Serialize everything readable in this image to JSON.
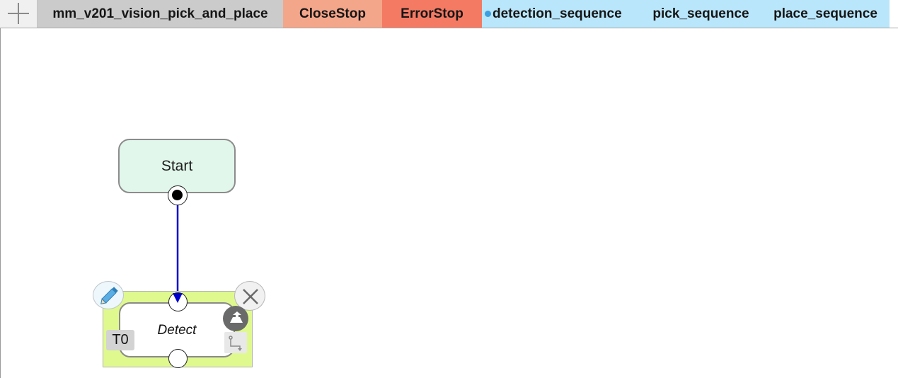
{
  "tabbar": {
    "add_icon": "plus-icon",
    "tabs": [
      {
        "label": "mm_v201_vision_pick_and_place",
        "color": "#cbcbcb"
      },
      {
        "label": "CloseStop",
        "color": "#f4a68a"
      },
      {
        "label": "ErrorStop",
        "color": "#f47a63"
      },
      {
        "label": "detection_sequence",
        "color": "#b9e6fb",
        "modified_dot": true
      },
      {
        "label": "pick_sequence",
        "color": "#b9e6fb"
      },
      {
        "label": "place_sequence",
        "color": "#b9e6fb"
      }
    ]
  },
  "canvas": {
    "start_node": {
      "label": "Start",
      "color": "#e2f7eb"
    },
    "detect_node": {
      "label": "Detect",
      "badge": "T0",
      "selection_color": "#dff98e"
    },
    "connector_color": "#0000cc",
    "node_actions": [
      "pencil-icon",
      "close-icon",
      "cloud-upload-icon",
      "route-icon"
    ]
  }
}
